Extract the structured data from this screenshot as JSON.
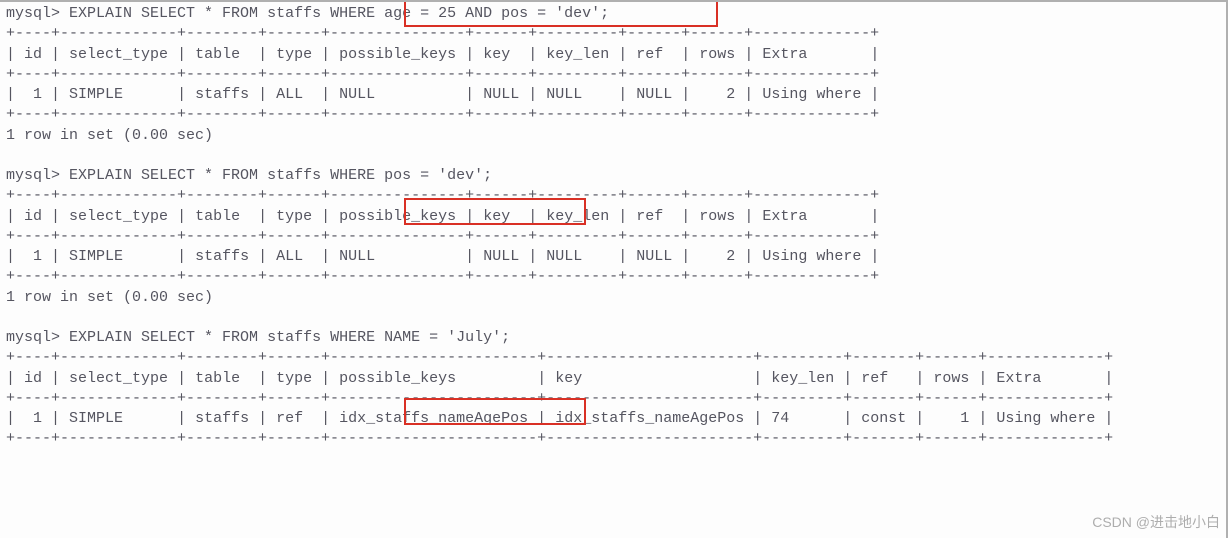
{
  "queries": [
    {
      "prompt": "mysql>",
      "sql_pre": "EXPLAIN SELECT * FROM staffs WHERE ",
      "sql_hl": "age = 25 AND pos = 'dev';",
      "cols": [
        "id",
        "select_type",
        "table",
        "type",
        "possible_keys",
        "key",
        "key_len",
        "ref",
        "rows",
        "Extra"
      ],
      "row": [
        "1",
        "SIMPLE",
        "staffs",
        "ALL",
        "NULL",
        "NULL",
        "NULL",
        "NULL",
        "2",
        "Using where"
      ],
      "result": "1 row in set (0.00 sec)"
    },
    {
      "prompt": "mysql>",
      "sql_pre": "EXPLAIN SELECT * FROM staffs WHERE ",
      "sql_hl": "pos = 'dev';",
      "cols": [
        "id",
        "select_type",
        "table",
        "type",
        "possible_keys",
        "key",
        "key_len",
        "ref",
        "rows",
        "Extra"
      ],
      "row": [
        "1",
        "SIMPLE",
        "staffs",
        "ALL",
        "NULL",
        "NULL",
        "NULL",
        "NULL",
        "2",
        "Using where"
      ],
      "result": "1 row in set (0.00 sec)"
    },
    {
      "prompt": "mysql>",
      "sql_pre": "EXPLAIN SELECT * FROM staffs WHERE ",
      "sql_hl": "NAME = 'July';",
      "cols": [
        "id",
        "select_type",
        "table",
        "type",
        "possible_keys",
        "key",
        "key_len",
        "ref",
        "rows",
        "Extra"
      ],
      "row": [
        "1",
        "SIMPLE",
        "staffs",
        "ref",
        "idx_staffs_nameAgePos",
        "idx_staffs_nameAgePos",
        "74",
        "const",
        "1",
        "Using where"
      ],
      "result": ""
    }
  ],
  "watermark": "CSDN @进击地小白"
}
